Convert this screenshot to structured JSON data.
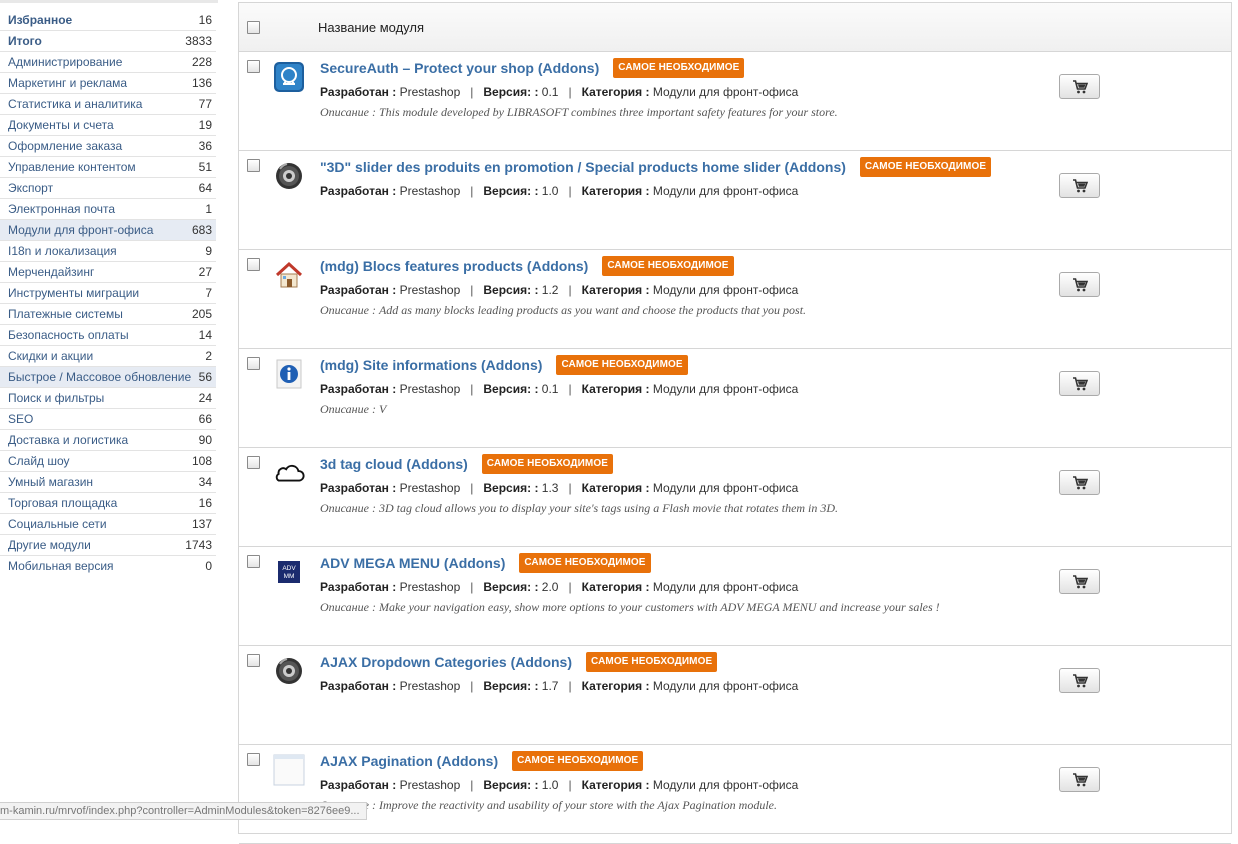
{
  "sidebar": {
    "items": [
      {
        "label": "Избранное",
        "count": "16"
      },
      {
        "label": "Итого",
        "count": "3833"
      },
      {
        "label": "Администрирование",
        "count": "228"
      },
      {
        "label": "Маркетинг и реклама",
        "count": "136"
      },
      {
        "label": "Статистика и аналитика",
        "count": "77"
      },
      {
        "label": "Документы и счета",
        "count": "19"
      },
      {
        "label": "Оформление заказа",
        "count": "36"
      },
      {
        "label": "Управление контентом",
        "count": "51"
      },
      {
        "label": "Экспорт",
        "count": "64"
      },
      {
        "label": "Электронная почта",
        "count": "1"
      },
      {
        "label": "Модули для фронт-офиса",
        "count": "683"
      },
      {
        "label": "I18n и локализация",
        "count": "9"
      },
      {
        "label": "Мерчендайзинг",
        "count": "27"
      },
      {
        "label": "Инструменты миграции",
        "count": "7"
      },
      {
        "label": "Платежные системы",
        "count": "205"
      },
      {
        "label": "Безопасность оплаты",
        "count": "14"
      },
      {
        "label": "Скидки и акции",
        "count": "2"
      },
      {
        "label": "Быстрое / Массовое обновление",
        "count": "56"
      },
      {
        "label": "Поиск и фильтры",
        "count": "24"
      },
      {
        "label": "SEO",
        "count": "66"
      },
      {
        "label": "Доставка и логистика",
        "count": "90"
      },
      {
        "label": "Слайд шоу",
        "count": "108"
      },
      {
        "label": "Умный магазин",
        "count": "34"
      },
      {
        "label": "Торговая площадка",
        "count": "16"
      },
      {
        "label": "Социальные сети",
        "count": "137"
      },
      {
        "label": "Другие модули",
        "count": "1743"
      },
      {
        "label": "Мобильная версия",
        "count": "0"
      }
    ]
  },
  "table": {
    "column_title": "Название модуля",
    "badge_label": "САМОЕ НЕОБХОДИМОЕ",
    "author_label": "Разработан :",
    "version_label": "Версия: :",
    "category_label": "Категория :",
    "separator": "|",
    "modules": [
      {
        "name": "SecureAuth – Protect your shop (Addons)",
        "author": "Prestashop",
        "version": "0.1",
        "category": "Модули для фронт-офиса",
        "description": "Описание : This module developed by LIBRASOFT combines three important safety features for your store.",
        "icon": "secureauth-icon"
      },
      {
        "name": "\"3D\" slider des produits en promotion / Special products home slider (Addons)",
        "author": "Prestashop",
        "version": "1.0",
        "category": "Модули для фронт-офиса",
        "description": "",
        "icon": "disc-icon"
      },
      {
        "name": "(mdg) Blocs features products (Addons)",
        "author": "Prestashop",
        "version": "1.2",
        "category": "Модули для фронт-офиса",
        "description": "Описание : Add as many blocks leading products as you want and choose the products that you post.",
        "icon": "house-icon"
      },
      {
        "name": "(mdg) Site informations (Addons)",
        "author": "Prestashop",
        "version": "0.1",
        "category": "Модули для фронт-офиса",
        "description": "Описание : V",
        "icon": "info-icon"
      },
      {
        "name": "3d tag cloud (Addons)",
        "author": "Prestashop",
        "version": "1.3",
        "category": "Модули для фронт-офиса",
        "description": "Описание : 3D tag cloud allows you to display your site's tags using a Flash movie that rotates them in 3D.",
        "icon": "cloud-icon"
      },
      {
        "name": "ADV MEGA MENU (Addons)",
        "author": "Prestashop",
        "version": "2.0",
        "category": "Модули для фронт-офиса",
        "description": "Описание : Make your navigation easy, show more options to your customers with ADV MEGA MENU and increase your sales !",
        "icon": "adv-menu-icon"
      },
      {
        "name": "AJAX Dropdown Categories (Addons)",
        "author": "Prestashop",
        "version": "1.7",
        "category": "Модули для фронт-офиса",
        "description": "",
        "icon": "disc-icon"
      },
      {
        "name": "AJAX Pagination (Addons)",
        "author": "Prestashop",
        "version": "1.0",
        "category": "Модули для фронт-офиса",
        "description": "Описание : Improve the reactivity and usability of your store with the Ajax Pagination module.",
        "icon": "blank-page-icon"
      }
    ]
  },
  "statusbar": {
    "url": "m-kamin.ru/mrvof/index.php?controller=AdminModules&token=8276ee9..."
  }
}
